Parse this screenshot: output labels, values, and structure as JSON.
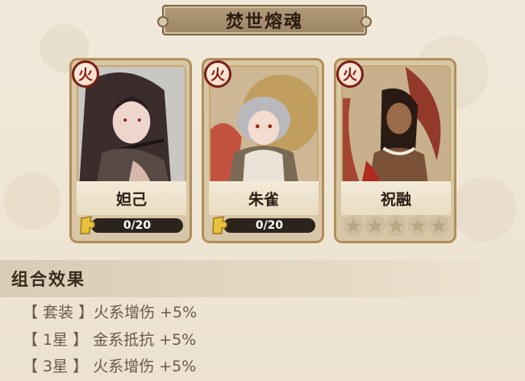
{
  "title": "焚世熔魂",
  "cards": [
    {
      "element": "火",
      "name": "妲己",
      "progress_text": "0/20",
      "progress_value": 0,
      "portrait_icon": "daji-portrait"
    },
    {
      "element": "火",
      "name": "朱雀",
      "progress_text": "0/20",
      "progress_value": 0,
      "portrait_icon": "zhuque-portrait"
    },
    {
      "element": "火",
      "name": "祝融",
      "stars_filled": 0,
      "stars_total": 5,
      "portrait_icon": "zhurong-portrait"
    }
  ],
  "combo": {
    "header": "组合效果",
    "effects": [
      "【 套装 】火系增伤 +5%",
      "【 1星 】 金系抵抗 +5%",
      "【 3星 】 火系增伤 +5%"
    ]
  },
  "colors": {
    "fire_badge": "#7a1e15",
    "shard_yellow": "#e2b53a",
    "card_border": "#b18e5b"
  }
}
